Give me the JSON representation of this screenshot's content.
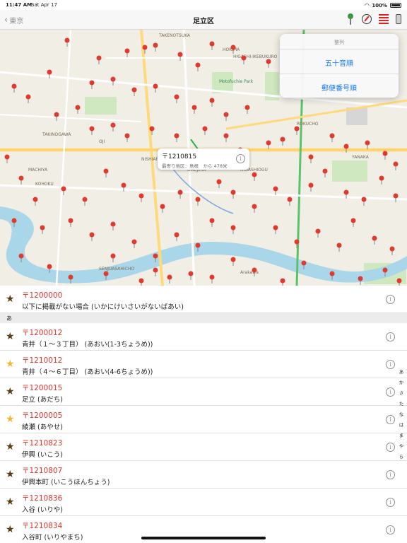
{
  "status_bar": {
    "time": "11:47 AM",
    "date": "Sat Apr 17",
    "battery": "100%"
  },
  "nav": {
    "back_label": "東京",
    "title": "足立区",
    "icons": [
      "map-pin-icon",
      "compass-icon",
      "sort-list-icon",
      "phone-icon"
    ]
  },
  "map": {
    "callout": {
      "code": "〒1210815",
      "detail": "最寄り地区：島根　から 478米"
    },
    "labels": [
      "IKEBUKURO",
      "HIGASHI-IKEBUKURO",
      "TAKINOGAWA",
      "OJI",
      "ARAKAWA",
      "MACHIYA",
      "NISHIARAI",
      "UMEJIMA",
      "KOHOKU",
      "SENJUASAHICHO",
      "HIGASHIOGU",
      "YANAKA",
      "ROKUCHO",
      "TAKENOTSUKA",
      "HOKIMA",
      "Motofuchie Park",
      "Arakawa"
    ],
    "colors": {
      "land": "#f1eee6",
      "park": "#cfe8c0",
      "river": "#a9d6e8",
      "road": "#ffd97a",
      "pin": "#e03a2f"
    }
  },
  "sort_menu": {
    "title": "整列",
    "options": [
      "五十音順",
      "郵便番号順"
    ]
  },
  "list": {
    "top_row": {
      "code": "〒1200000",
      "name": "以下に掲載がない場合 (いかにけいさいがないばあい)",
      "star": "brown"
    },
    "section": "あ",
    "rows": [
      {
        "code": "〒1200012",
        "name": "青井（１～３丁目） (あおい(1-3ちょうめ))",
        "star": "brown"
      },
      {
        "code": "〒1210012",
        "name": "青井（４～６丁目） (あおい(4-6ちょうめ))",
        "star": "gold"
      },
      {
        "code": "〒1200015",
        "name": "足立 (あだち)",
        "star": "brown"
      },
      {
        "code": "〒1200005",
        "name": "綾瀬 (あやせ)",
        "star": "gold"
      },
      {
        "code": "〒1210823",
        "name": "伊興 (いこう)",
        "star": "brown"
      },
      {
        "code": "〒1210807",
        "name": "伊興本町 (いこうほんちょう)",
        "star": "brown"
      },
      {
        "code": "〒1210836",
        "name": "入谷 (いりや)",
        "star": "brown"
      },
      {
        "code": "〒1210834",
        "name": "入谷町 (いりやまち)",
        "star": "brown"
      }
    ]
  },
  "index_bar": [
    "あ",
    "か",
    "さ",
    "た",
    "な",
    "は",
    "ま",
    "や",
    "ら"
  ]
}
